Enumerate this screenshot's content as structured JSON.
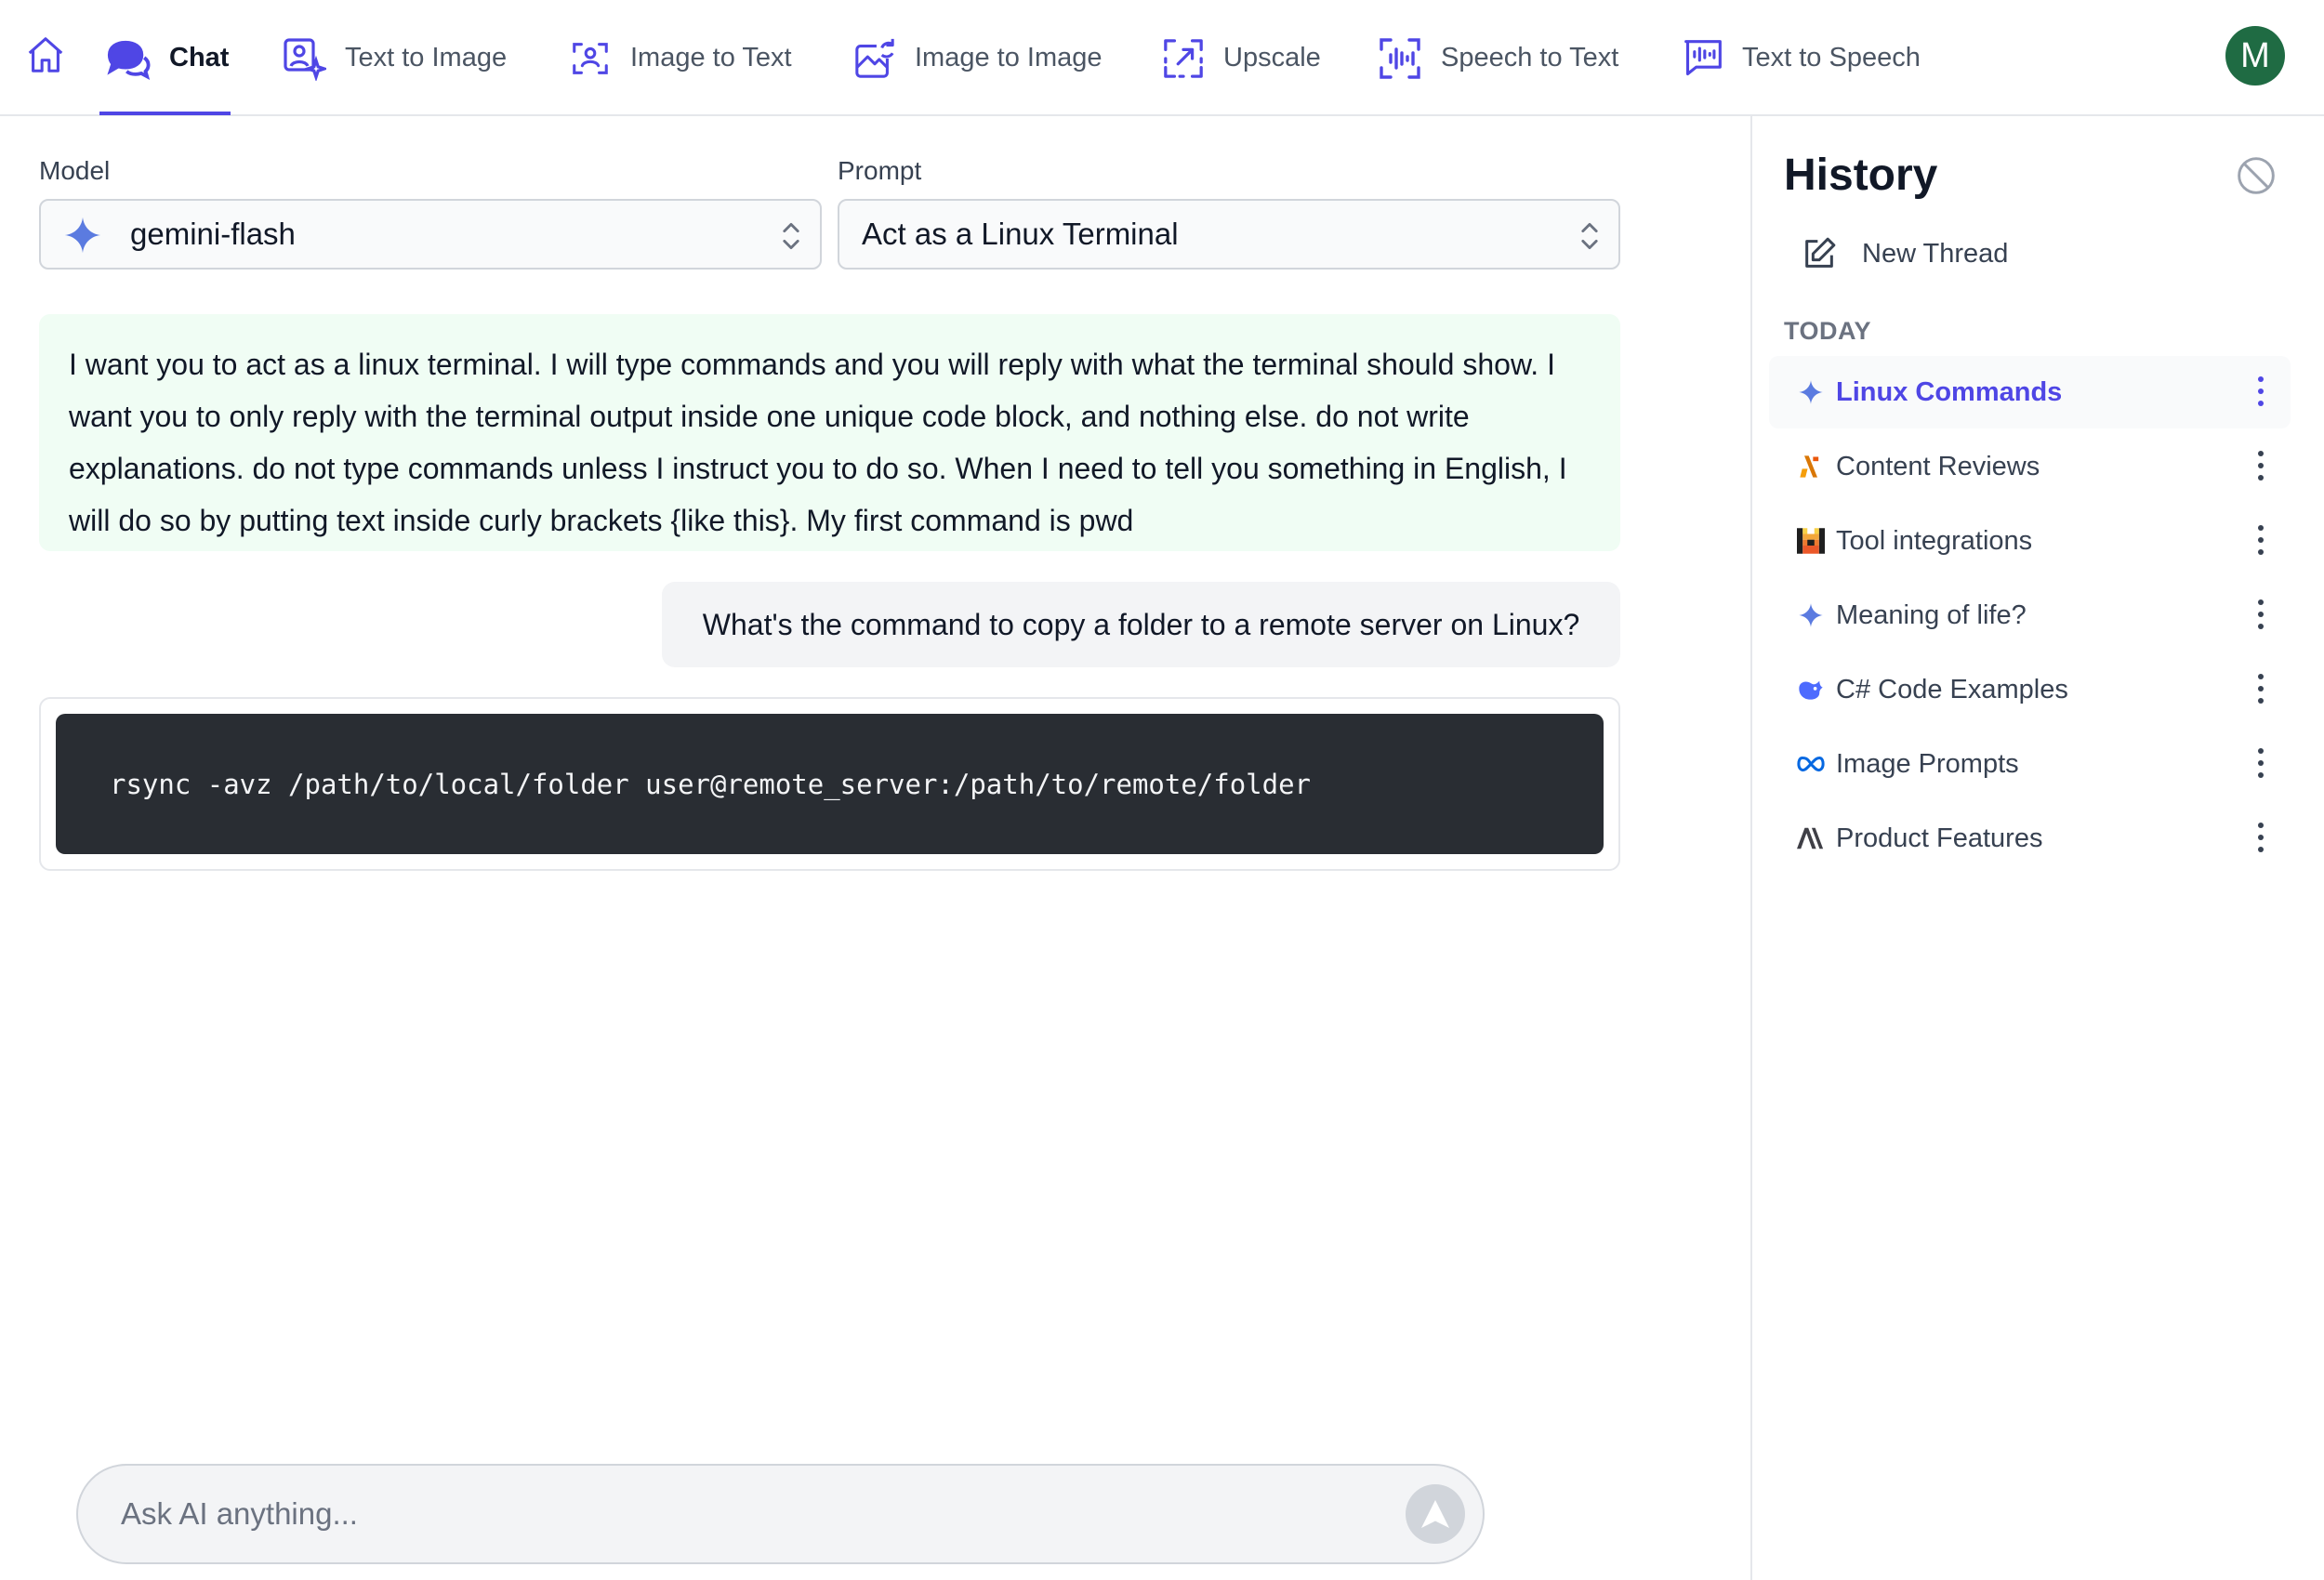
{
  "nav": {
    "tabs": [
      {
        "label": "Chat",
        "icon": "chat-icon",
        "active": true
      },
      {
        "label": "Text to Image",
        "icon": "text-to-image-icon"
      },
      {
        "label": "Image to Text",
        "icon": "image-to-text-icon"
      },
      {
        "label": "Image to Image",
        "icon": "image-to-image-icon"
      },
      {
        "label": "Upscale",
        "icon": "upscale-icon"
      },
      {
        "label": "Speech to Text",
        "icon": "speech-to-text-icon"
      },
      {
        "label": "Text to Speech",
        "icon": "text-to-speech-icon"
      }
    ],
    "avatar_initial": "M"
  },
  "model": {
    "label": "Model",
    "value": "gemini-flash"
  },
  "prompt": {
    "label": "Prompt",
    "value": "Act as a Linux Terminal"
  },
  "conversation": {
    "system_message": "I want you to act as a linux terminal. I will type commands and you will reply with what the terminal should show. I want you to only reply with the terminal output inside one unique code block, and nothing else. do not write explanations. do not type commands unless I instruct you to do so. When I need to tell you something in English, I will do so by putting text inside curly brackets {like this}. My first command is pwd",
    "user_message": "What's the command to copy a folder to a remote server on Linux?",
    "assistant_code": "rsync -avz /path/to/local/folder user@remote_server:/path/to/remote/folder"
  },
  "composer": {
    "placeholder": "Ask AI anything..."
  },
  "history": {
    "title": "History",
    "new_thread": "New Thread",
    "section": "TODAY",
    "items": [
      {
        "label": "Linux Commands",
        "icon": "gemini-sparkle-icon",
        "selected": true
      },
      {
        "label": "Content Reviews",
        "icon": "model-logo-icon"
      },
      {
        "label": "Tool integrations",
        "icon": "mistral-logo-icon"
      },
      {
        "label": "Meaning of life?",
        "icon": "gemini-sparkle-icon"
      },
      {
        "label": "C# Code Examples",
        "icon": "deepseek-logo-icon"
      },
      {
        "label": "Image Prompts",
        "icon": "meta-logo-icon"
      },
      {
        "label": "Product Features",
        "icon": "anthropic-logo-icon"
      }
    ]
  },
  "colors": {
    "accent": "#4f46e5",
    "avatar": "#1f6b43",
    "code_bg": "#292d33",
    "system_bg": "#f0fdf4"
  }
}
